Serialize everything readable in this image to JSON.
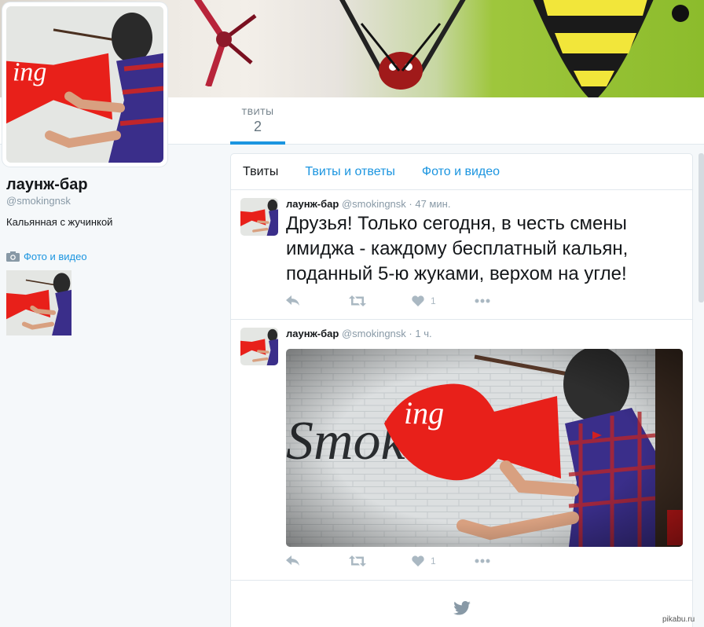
{
  "profile": {
    "name": "лаунж-бар",
    "handle": "@smokingnsk",
    "bio": "Кальянная с жучинкой",
    "photo_link": "Фото и видео"
  },
  "nav": {
    "tweets_label": "ТВИТЫ",
    "tweets_count": "2"
  },
  "timeline": {
    "tabs": [
      "Твиты",
      "Твиты и ответы",
      "Фото и видео"
    ]
  },
  "tweets": [
    {
      "name": "лаунж-бар",
      "handle": "@smokingnsk",
      "time": "· 47 мин.",
      "text": "Друзья! Только сегодня, в честь смены имиджа - каждому бесплатный кальян, поданный 5-ю жуками, верхом на угле!",
      "likes": "1"
    },
    {
      "name": "лаунж-бар",
      "handle": "@smokingnsk",
      "time": "· 1 ч.",
      "likes": "1"
    }
  ],
  "watermark": "pikabu.ru",
  "colors": {
    "accent": "#1b95e0",
    "red_bow": "#e8201a"
  },
  "icons": [
    "camera-icon",
    "reply-icon",
    "retweet-icon",
    "heart-icon",
    "more-icon",
    "twitter-bird-icon"
  ]
}
